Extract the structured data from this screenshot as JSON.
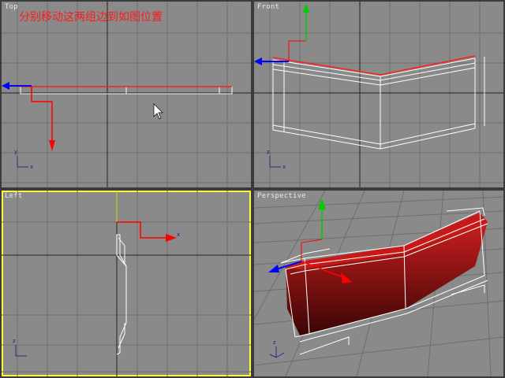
{
  "viewports": {
    "top": {
      "label": "Top",
      "active": false
    },
    "front": {
      "label": "Front",
      "active": false
    },
    "left": {
      "label": "Left",
      "active": true
    },
    "perspective": {
      "label": "Perspective",
      "active": false
    }
  },
  "annotation": "分别移动这两组边到如图位置",
  "axis_labels": {
    "x": "x",
    "y": "y",
    "z": "z"
  },
  "colors": {
    "viewport_bg": "#8a8a8a",
    "grid": "#6e6e6e",
    "grid_major": "#222222",
    "active_border": "#ffff40",
    "annotation": "#ff1a1a",
    "gizmo_x": "#ff0000",
    "gizmo_y": "#00cc00",
    "gizmo_z": "#0000ff",
    "wire": "#ffffff",
    "selected_edge": "#ff2020",
    "mesh_red": "#b01010"
  }
}
